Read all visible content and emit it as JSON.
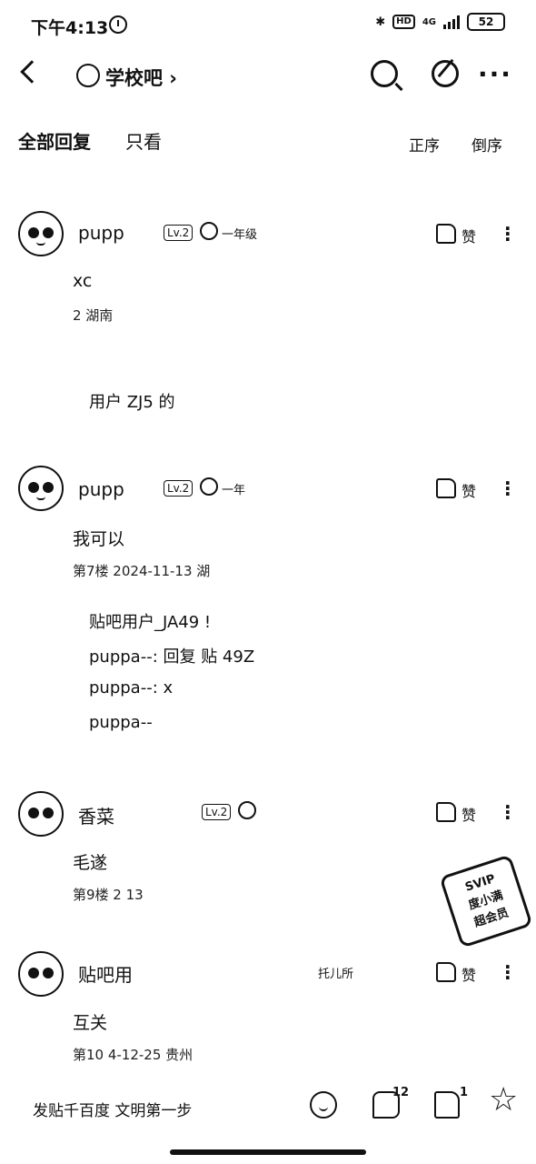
{
  "status_bar": {
    "time": "下午4:13",
    "network": "4G",
    "hd": "HD",
    "battery": "52"
  },
  "nav": {
    "forum_name": "学校吧 ›"
  },
  "filters": {
    "all_replies": "全部回复",
    "only_view": "只看",
    "sort_asc": "正序",
    "sort_desc": "倒序"
  },
  "posts": [
    {
      "username": "pupp",
      "level": "Lv.2",
      "grade": "一年级",
      "like_label": "赞",
      "content": "xc",
      "meta": "2                    湖南",
      "replies": [
        "",
        "用户       ZJ5       的"
      ]
    },
    {
      "username": "pupp",
      "level": "Lv.2",
      "grade": "一年",
      "like_label": "赞",
      "content": "我可以",
      "meta": "第7楼  2024-11-13  湖",
      "replies": [
        "贴吧用户_JA49            !",
        "puppa--: 回复 贴           49Z",
        "puppa--: x",
        "puppa--"
      ]
    },
    {
      "username": "香菜",
      "level": "Lv.2",
      "grade": "",
      "like_label": "赞",
      "content": "毛遂",
      "meta": "第9楼  2             13",
      "replies": []
    },
    {
      "username": "贴吧用",
      "level": "",
      "grade": "托儿所",
      "like_label": "赞",
      "content": "互关",
      "meta": "第10        4-12-25  贵州",
      "replies": []
    }
  ],
  "stamp": {
    "line1": "SVIP",
    "line2": "度小满",
    "line3": "超会员"
  },
  "bottom_bar": {
    "input_placeholder": "发贴千百度 文明第一步",
    "comment_count": "12",
    "like_count": "1"
  }
}
